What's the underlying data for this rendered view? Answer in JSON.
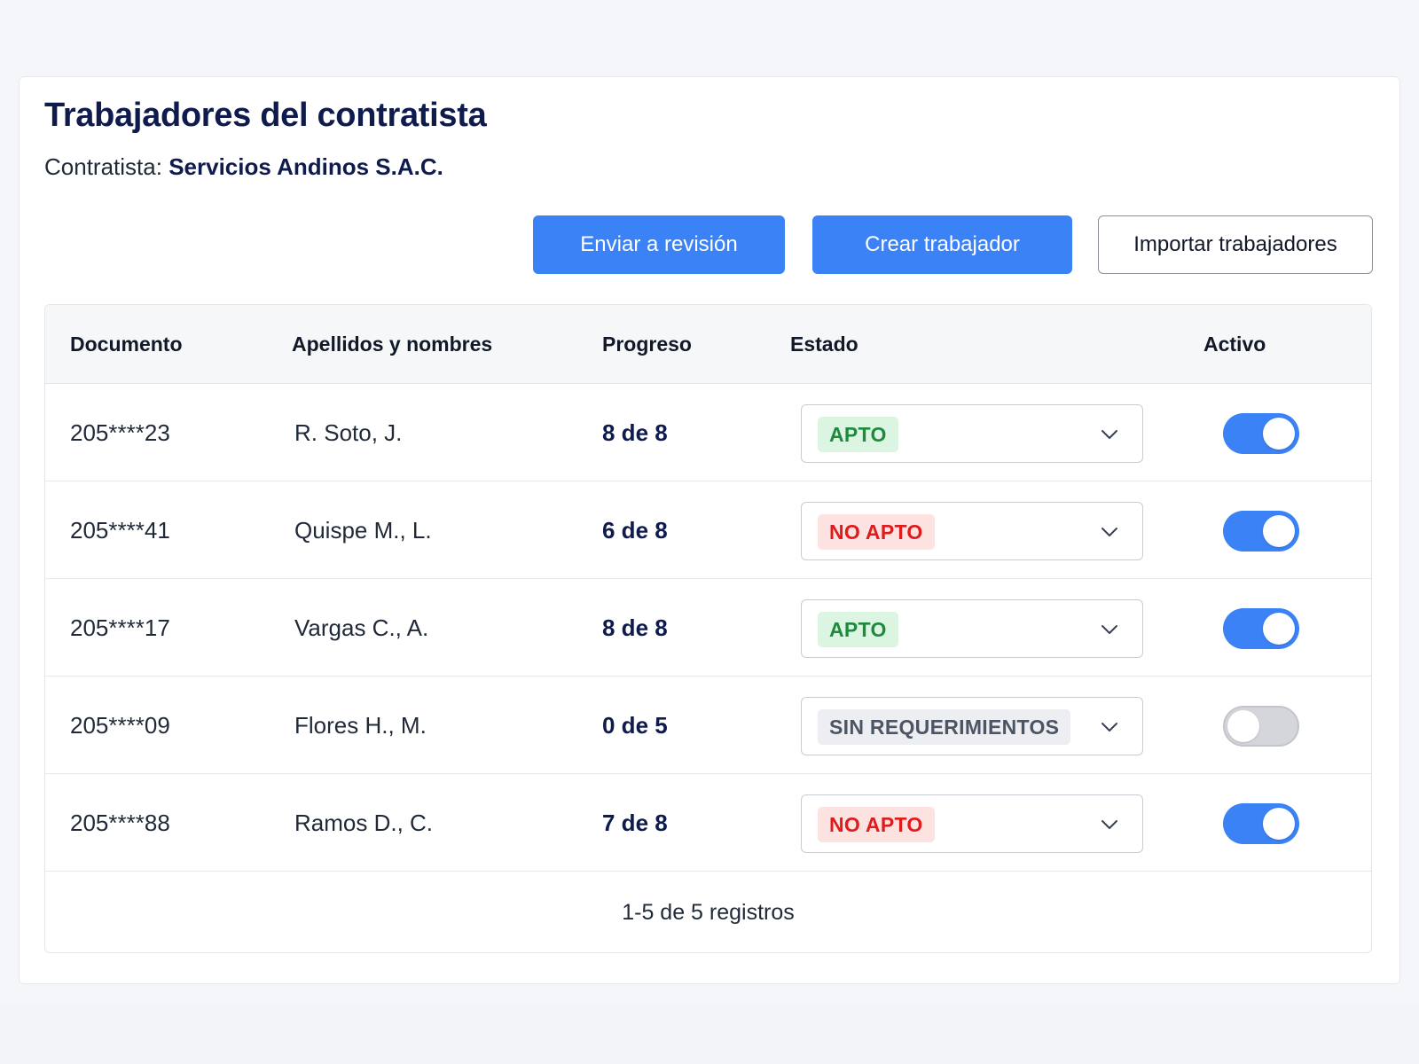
{
  "header": {
    "title": "Trabajadores del contratista",
    "contractor_label": "Contratista:",
    "contractor_name": "Servicios Andinos S.A.C."
  },
  "actions": {
    "send_label": "Enviar a revisión",
    "create_label": "Crear trabajador",
    "import_label": "Importar trabajadores"
  },
  "table": {
    "columns": [
      "Documento",
      "Apellidos y nombres",
      "Progreso",
      "Estado",
      "Activo"
    ],
    "rows": [
      {
        "documento": "205****23",
        "nombre": "R. Soto, J.",
        "progreso": "8 de 8",
        "estado": "APTO",
        "activo": true
      },
      {
        "documento": "205****41",
        "nombre": "Quispe M., L.",
        "progreso": "6 de 8",
        "estado": "NO APTO",
        "activo": true
      },
      {
        "documento": "205****17",
        "nombre": "Vargas C., A.",
        "progreso": "8 de 8",
        "estado": "APTO",
        "activo": true
      },
      {
        "documento": "205****09",
        "nombre": "Flores H., M.",
        "progreso": "0 de 5",
        "estado": "SIN REQUERIMIENTOS",
        "activo": false
      },
      {
        "documento": "205****88",
        "nombre": "Ramos D., C.",
        "progreso": "7 de 8",
        "estado": "NO APTO",
        "activo": true
      }
    ],
    "footer": "1-5 de 5 registros"
  },
  "icons": {
    "select_arrow": "chevron-down-icon"
  },
  "colors": {
    "primary": "#3b82f6",
    "title": "#0f1b4d",
    "apto_bg": "#dcf5e3",
    "apto_text": "#1e8a3c",
    "noapto_bg": "#fde2e2",
    "noapto_text": "#e01b1b",
    "sinreq_bg": "#eceef1",
    "sinreq_text": "#4b5563"
  }
}
